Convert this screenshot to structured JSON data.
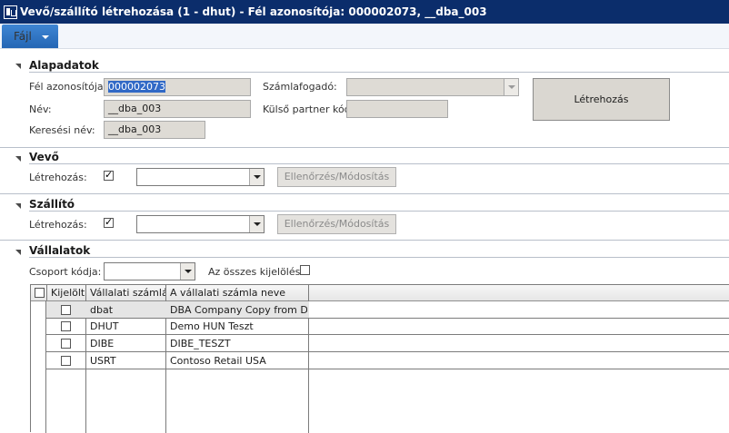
{
  "window": {
    "title": "Vevő/szállító létrehozása (1 - dhut) - Fél azonosítója: 000002073, __dba_003"
  },
  "menu": {
    "file_label": "Fájl"
  },
  "alapadatok": {
    "title": "Alapadatok",
    "party_id_label": "Fél azonosítója:",
    "party_id_value": "000002073",
    "name_label": "Név:",
    "name_value": "__dba_003",
    "search_name_label": "Keresési név:",
    "search_name_value": "__dba_003",
    "recipient_label": "Számlafogadó:",
    "recipient_value": "",
    "external_label": "Külső partner kód:",
    "external_value": "",
    "create_button": "Létrehozás"
  },
  "vevo": {
    "title": "Vevő",
    "create_label": "Létrehozás:",
    "create_checked": true,
    "combo_value": "",
    "check_button": "Ellenőrzés/Módosítás"
  },
  "szallito": {
    "title": "Szállító",
    "create_label": "Létrehozás:",
    "create_checked": true,
    "combo_value": "",
    "check_button": "Ellenőrzés/Módosítás"
  },
  "vallalatok": {
    "title": "Vállalatok",
    "group_label": "Csoport kódja:",
    "group_value": "",
    "select_all_label": "Az összes kijelölése:",
    "select_all_checked": false,
    "columns": [
      "Kijelölt",
      "Vállalati számlák",
      "A vállalati számla neve"
    ],
    "rows": [
      {
        "selected": false,
        "code": "dbat",
        "name": "DBA Company Copy from D..."
      },
      {
        "selected": false,
        "code": "DHUT",
        "name": "Demo HUN Teszt"
      },
      {
        "selected": false,
        "code": "DIBE",
        "name": "DIBE_TESZT"
      },
      {
        "selected": false,
        "code": "USRT",
        "name": "Contoso Retail USA"
      }
    ]
  }
}
